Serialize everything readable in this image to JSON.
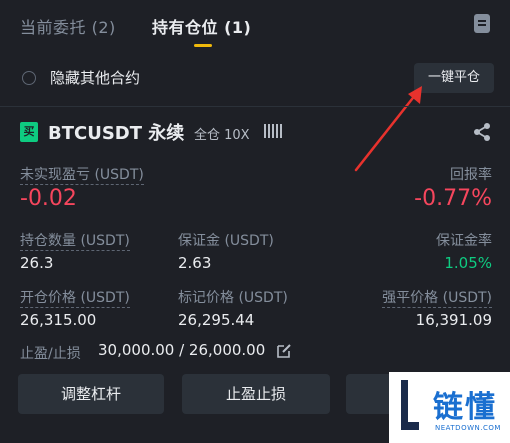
{
  "tabs": {
    "orders_label": "当前委托 (2)",
    "positions_label": "持有仓位 (1)"
  },
  "toolbar": {
    "hide_others_label": "隐藏其他合约",
    "close_all_label": "一键平仓"
  },
  "position": {
    "side_badge": "买",
    "symbol": "BTCUSDT 永续",
    "margin_mode": "全仓 10X",
    "unrealized_pnl_label": "未实现盈亏 (USDT)",
    "unrealized_pnl_value": "-0.02",
    "roe_label": "回报率",
    "roe_value": "-0.77%",
    "size_label": "持仓数量 (USDT)",
    "size_value": "26.3",
    "margin_label": "保证金 (USDT)",
    "margin_value": "2.63",
    "margin_ratio_label": "保证金率",
    "margin_ratio_value": "1.05%",
    "entry_price_label": "开仓价格 (USDT)",
    "entry_price_value": "26,315.00",
    "mark_price_label": "标记价格 (USDT)",
    "mark_price_value": "26,295.44",
    "liq_price_label": "强平价格 (USDT)",
    "liq_price_value": "16,391.09",
    "tpsl_label": "止盈/止损",
    "tpsl_value": "30,000.00 / 26,000.00"
  },
  "actions": {
    "adjust_leverage_label": "调整杠杆",
    "tpsl_button_label": "止盈止损",
    "close_label": ""
  },
  "watermark": {
    "text": "链懂",
    "sub": "NEATDOWN.COM"
  },
  "colors": {
    "accent": "#f0b90b",
    "loss": "#f6465d",
    "gain": "#0ecb81",
    "annotation_arrow": "#e8322d"
  }
}
